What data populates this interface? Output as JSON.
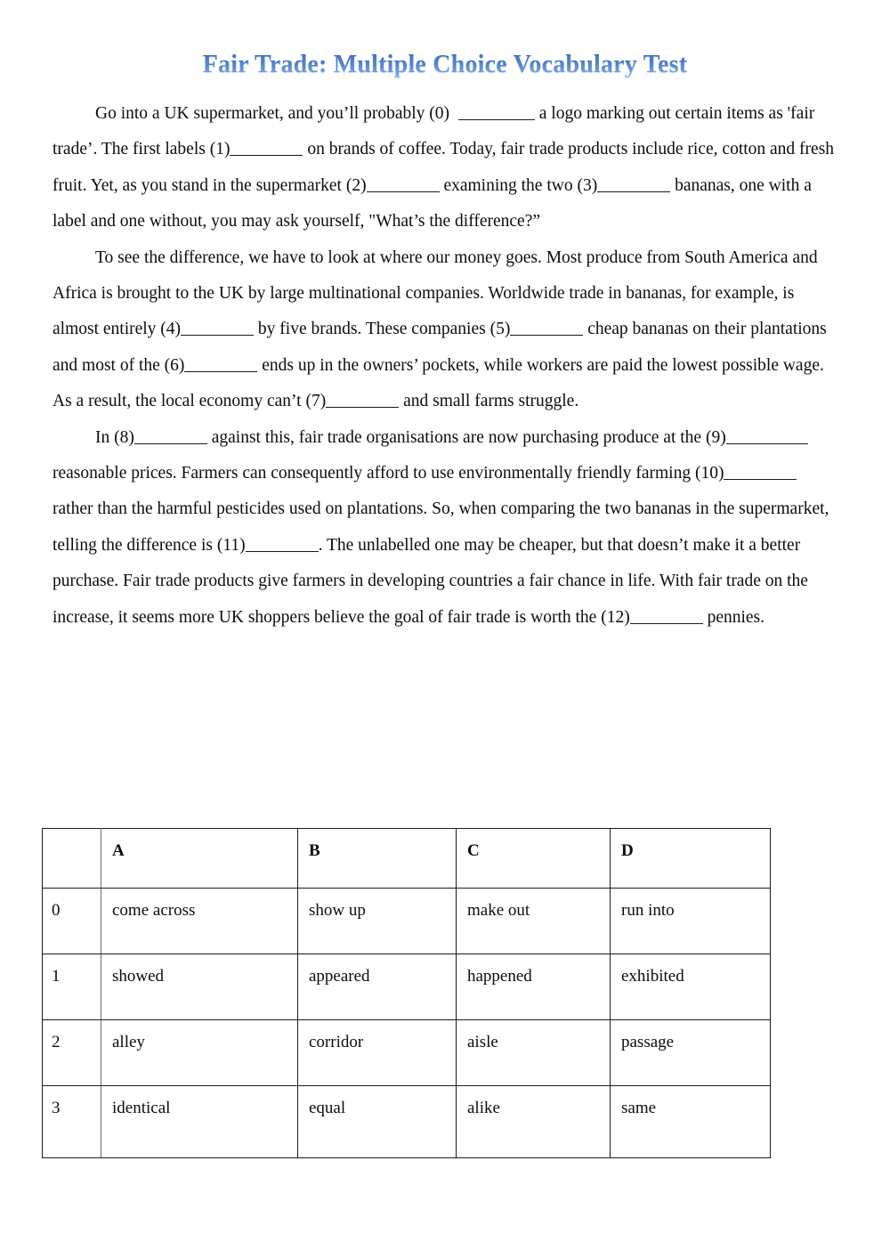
{
  "document": {
    "title": "Fair Trade: Multiple Choice Vocabulary Test",
    "title_color": "#3f6fc4"
  },
  "passage": {
    "paragraphs": [
      {
        "id": "p1",
        "segments": [
          {
            "t": "text",
            "v": "Go into a UK supermarket, and you’ll probably (0) "
          },
          {
            "t": "blank",
            "v": "",
            "n": "0",
            "w": "sp"
          },
          {
            "t": "text",
            "v": " a logo marking out certain items as 'fair trade’. The first labels (1)"
          },
          {
            "t": "blank",
            "v": "",
            "n": "1",
            "w": "std"
          },
          {
            "t": "text",
            "v": " on brands of coffee. Today, fair trade products include rice, cotton and fresh fruit. Yet, as you stand in the supermarket (2)"
          },
          {
            "t": "blank",
            "v": "",
            "n": "2",
            "w": "std"
          },
          {
            "t": "text",
            "v": " examining the two (3)"
          },
          {
            "t": "blank",
            "v": "",
            "n": "3",
            "w": "std"
          },
          {
            "t": "text",
            "v": " bananas, one with a label and one without, you may ask yourself, \"What’s the difference?”"
          }
        ]
      },
      {
        "id": "p2",
        "segments": [
          {
            "t": "text",
            "v": "To see the difference, we have to look at where our money goes. Most produce from South America and Africa is brought to the UK by large multinational companies. Worldwide trade in bananas, for example, is almost entirely (4)"
          },
          {
            "t": "blank",
            "v": "",
            "n": "4",
            "w": "std"
          },
          {
            "t": "text",
            "v": " by five brands. These companies (5)"
          },
          {
            "t": "blank",
            "v": "",
            "n": "5",
            "w": "std"
          },
          {
            "t": "text",
            "v": " cheap bananas on their plantations and most of the (6)"
          },
          {
            "t": "blank",
            "v": "",
            "n": "6",
            "w": "std"
          },
          {
            "t": "text",
            "v": " ends up in the owners’ pockets, while workers are paid the lowest possible wage. As a result, the local economy can’t (7)"
          },
          {
            "t": "blank",
            "v": "",
            "n": "7",
            "w": "std"
          },
          {
            "t": "text",
            "v": " and small farms struggle."
          }
        ]
      },
      {
        "id": "p3",
        "segments": [
          {
            "t": "text",
            "v": "In (8)"
          },
          {
            "t": "blank",
            "v": "",
            "n": "8",
            "w": "std"
          },
          {
            "t": "text",
            "v": " against this, fair trade organisations are now purchasing produce at the (9)"
          },
          {
            "t": "blank",
            "v": "",
            "n": "9",
            "w": "wide"
          },
          {
            "t": "text",
            "v": " reasonable prices. Farmers can consequently afford to use environmentally friendly farming (10)"
          },
          {
            "t": "blank",
            "v": "",
            "n": "10",
            "w": "std"
          },
          {
            "t": "text",
            "v": " rather than the harmful pesticides used on plantations. So, when comparing the two bananas in the supermarket, telling the difference is (11)"
          },
          {
            "t": "blank",
            "v": "",
            "n": "11",
            "w": "std"
          },
          {
            "t": "text",
            "v": ". The unlabelled one may be cheaper, but that doesn’t make it a better purchase. Fair trade products give farmers in developing countries a fair chance in life. With fair trade on the increase, it seems more UK shoppers believe the goal of fair trade is worth the (12)"
          },
          {
            "t": "blank",
            "v": "",
            "n": "12",
            "w": "std"
          },
          {
            "t": "text",
            "v": " pennies."
          }
        ]
      }
    ]
  },
  "options_table": {
    "headers": [
      "",
      "A",
      "B",
      "C",
      "D"
    ],
    "rows": [
      {
        "number": "0",
        "a": "come across",
        "b": "show up",
        "c": "make out",
        "d": "run into"
      },
      {
        "number": "1",
        "a": "showed",
        "b": "appeared",
        "c": "happened",
        "d": "exhibited"
      },
      {
        "number": "2",
        "a": "alley",
        "b": "corridor",
        "c": "aisle",
        "d": "passage"
      },
      {
        "number": "3",
        "a": "identical",
        "b": "equal",
        "c": "alike",
        "d": "same"
      }
    ]
  }
}
